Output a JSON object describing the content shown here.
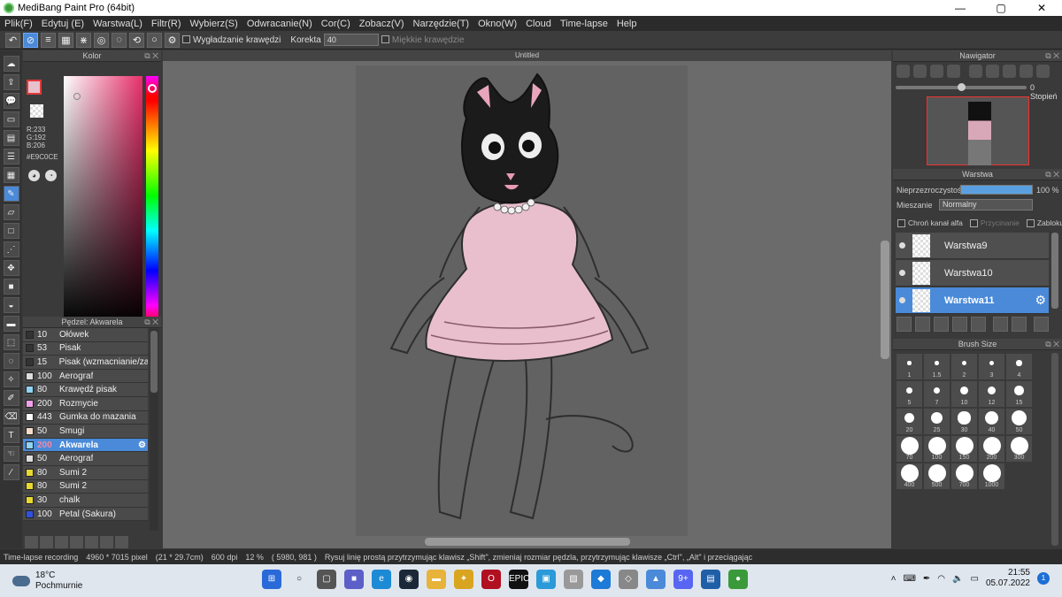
{
  "titlebar": {
    "title": "MediBang Paint Pro (64bit)",
    "minimize": "—",
    "maximize": "▢",
    "close": "✕"
  },
  "menu": [
    "Plik(F)",
    "Edytuj (E)",
    "Warstwa(L)",
    "Filtr(R)",
    "Wybierz(S)",
    "Odwracanie(N)",
    "Cor(C)",
    "Zobacz(V)",
    "Narzędzie(T)",
    "Okno(W)",
    "Cloud",
    "Time-lapse",
    "Help"
  ],
  "toolbar": {
    "antialias_label": "Wygładzanie krawędzi",
    "correction_label": "Korekta",
    "correction_value": "40",
    "soft_edges_label": "Miękkie krawędzie"
  },
  "color_panel": {
    "title": "Kolor",
    "main_color": "#E9C0CE",
    "r": "R:233",
    "g": "G:192",
    "b": "B:206",
    "hex": "#E9C0CE"
  },
  "brush_panel": {
    "title": "Pędzel: Akwarela",
    "brushes": [
      {
        "size": "10",
        "name": "Ołówek",
        "color": "#333333"
      },
      {
        "size": "53",
        "name": "Pisak",
        "color": "#333333"
      },
      {
        "size": "15",
        "name": "Pisak (wzmacnianie/za",
        "color": "#333333"
      },
      {
        "size": "100",
        "name": "Aerograf",
        "color": "#dddddd"
      },
      {
        "size": "80",
        "name": "Krawędź pisak",
        "color": "#8fd3f5"
      },
      {
        "size": "200",
        "name": "Rozmycie",
        "color": "#f0a0e8"
      },
      {
        "size": "443",
        "name": "Gumka do mazania",
        "color": "#ffffff"
      },
      {
        "size": "50",
        "name": "Smugi",
        "color": "#f5dcc8"
      },
      {
        "size": "200",
        "name": "Akwarela",
        "color": "#8fd3f5",
        "selected": true
      },
      {
        "size": "50",
        "name": "Aerograf",
        "color": "#dddddd"
      },
      {
        "size": "80",
        "name": "Sumi 2",
        "color": "#e8d830"
      },
      {
        "size": "80",
        "name": "Sumi 2",
        "color": "#e8d830"
      },
      {
        "size": "30",
        "name": "chalk",
        "color": "#e8d830"
      },
      {
        "size": "100",
        "name": "Petal (Sakura)",
        "color": "#3050e0"
      }
    ]
  },
  "canvas": {
    "title": "Untitled"
  },
  "navigator": {
    "title": "Nawigator",
    "zoom": "0 Stopień"
  },
  "layers": {
    "title": "Warstwa",
    "opacity_label": "Nieprzezroczystość",
    "opacity_value": "100 %",
    "opacity": 1.0,
    "blend_label": "Mieszanie",
    "blend_value": "Normalny",
    "protect_alpha": "Chroń kanał alfa",
    "clipping": "Przycinanie",
    "lock": "Zablokuj",
    "items": [
      {
        "name": "Warstwa9",
        "selected": false
      },
      {
        "name": "Warstwa10",
        "selected": false
      },
      {
        "name": "Warstwa11",
        "selected": true
      }
    ]
  },
  "brush_size": {
    "title": "Brush Size",
    "sizes": [
      "1",
      "1.5",
      "2",
      "3",
      "4",
      "5",
      "7",
      "10",
      "12",
      "15",
      "20",
      "25",
      "30",
      "40",
      "50",
      "70",
      "100",
      "150",
      "200",
      "300",
      "400",
      "500",
      "700",
      "1000"
    ]
  },
  "status": {
    "recording": "Time-lapse recording",
    "pixels": "4960 * 7015 pixel",
    "cm": "(21 * 29.7cm)",
    "dpi": "600 dpi",
    "zoom": "12 %",
    "coords": "( 5980, 981 )",
    "hint": "Rysuj linię prostą przytrzymując klawisz „Shift\", zmieniaj rozmiar pędzla, przytrzymując klawisze „Ctrl\", „Alt\" i przeciągając"
  },
  "taskbar": {
    "temp": "18°C",
    "weather": "Pochmurnie",
    "time": "21:55",
    "date": "05.07.2022",
    "notif_count": "9+",
    "steam_label": "EPIC"
  }
}
